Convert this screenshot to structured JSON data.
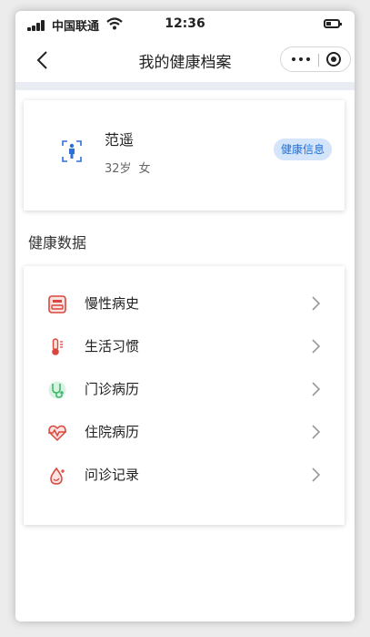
{
  "status_bar": {
    "carrier": "中国联通",
    "time": "12:36"
  },
  "nav": {
    "title": "我的健康档案"
  },
  "profile": {
    "name": "范遥",
    "age": "32岁",
    "gender": "女",
    "badge": "健康信息"
  },
  "section_title": "健康数据",
  "items": [
    {
      "label": "慢性病史",
      "icon": "scale-icon",
      "color": "#d9463b"
    },
    {
      "label": "生活习惯",
      "icon": "thermometer-icon",
      "color": "#d9463b"
    },
    {
      "label": "门诊病历",
      "icon": "stethoscope-icon",
      "color": "#3cb96a"
    },
    {
      "label": "住院病历",
      "icon": "heartbeat-icon",
      "color": "#d9463b"
    },
    {
      "label": "问诊记录",
      "icon": "consult-drop-icon",
      "color": "#d9463b"
    }
  ],
  "colors": {
    "accent": "#1f6fd8",
    "badge_bg": "#d3e4fb",
    "strip": "#e9edf3"
  }
}
